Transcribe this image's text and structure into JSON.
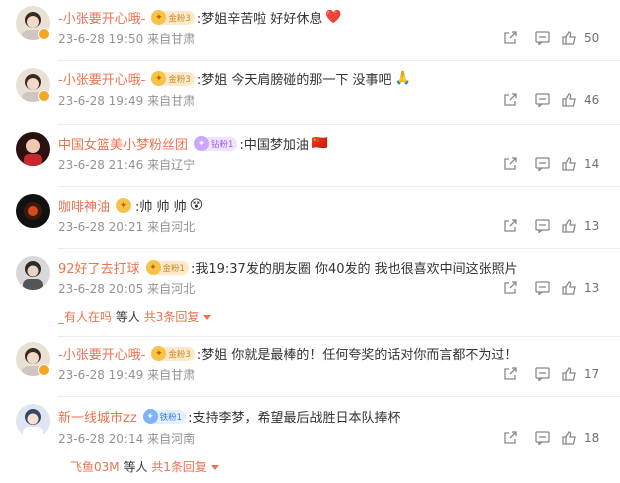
{
  "comments": [
    {
      "user": "-小张要开心哦-",
      "badge": "金粉3",
      "text": ":梦姐辛苦啦 好好休息",
      "emoji": "❤️",
      "time": "23-6-28 19:50",
      "loc": "来自甘肃",
      "likes": "50",
      "avatar": "girl"
    },
    {
      "user": "-小张要开心哦-",
      "badge": "金粉3",
      "text": ":梦姐 今天肩膀碰的那一下 没事吧",
      "emoji": "🙏",
      "time": "23-6-28 19:49",
      "loc": "来自甘肃",
      "likes": "46",
      "avatar": "girl"
    },
    {
      "user": "中国女篮美小梦粉丝团",
      "badge": "钻粉1",
      "text": ":中国梦加油",
      "emoji": "🇨🇳",
      "time": "23-6-28 21:46",
      "loc": "来自辽宁",
      "likes": "14",
      "avatar": "team"
    },
    {
      "user": "咖啡神油",
      "badge": "",
      "text": ":帅 帅 帅",
      "emoji": "😵",
      "time": "23-6-28 20:21",
      "loc": "来自河北",
      "likes": "13",
      "avatar": "dark"
    },
    {
      "user": "92好了去打球",
      "badge": "金粉1",
      "text": ":我19:37发的朋友圈 你40发的 我也很喜欢中间这张照片",
      "emoji": "",
      "time": "23-6-28 20:05",
      "loc": "来自河北",
      "likes": "13",
      "avatar": "person",
      "sub": {
        "who": "_有人在吗",
        "mid": "等人",
        "more": "共3条回复"
      }
    },
    {
      "user": "-小张要开心哦-",
      "badge": "金粉3",
      "text": ":梦姐 你就是最棒的！任何夸奖的话对你而言都不为过！",
      "emoji": "",
      "time": "23-6-28 19:49",
      "loc": "来自甘肃",
      "likes": "17",
      "avatar": "girl"
    },
    {
      "user": "新一线城市zz",
      "badge": "铁粉1",
      "text": ":支持李梦，希望最后战胜日本队捧杯",
      "emoji": "",
      "time": "23-6-28 20:14",
      "loc": "来自河南",
      "likes": "18",
      "avatar": "anime",
      "sub": {
        "who": "飞鱼03M",
        "mid": "等人",
        "more": "共1条回复"
      }
    }
  ],
  "icons": {
    "share": "share-icon",
    "comment": "comment-icon",
    "like": "thumbs-up-icon"
  },
  "colors": {
    "username": "#eb7350",
    "meta": "#939393",
    "badge_gold": "#f6c347"
  }
}
